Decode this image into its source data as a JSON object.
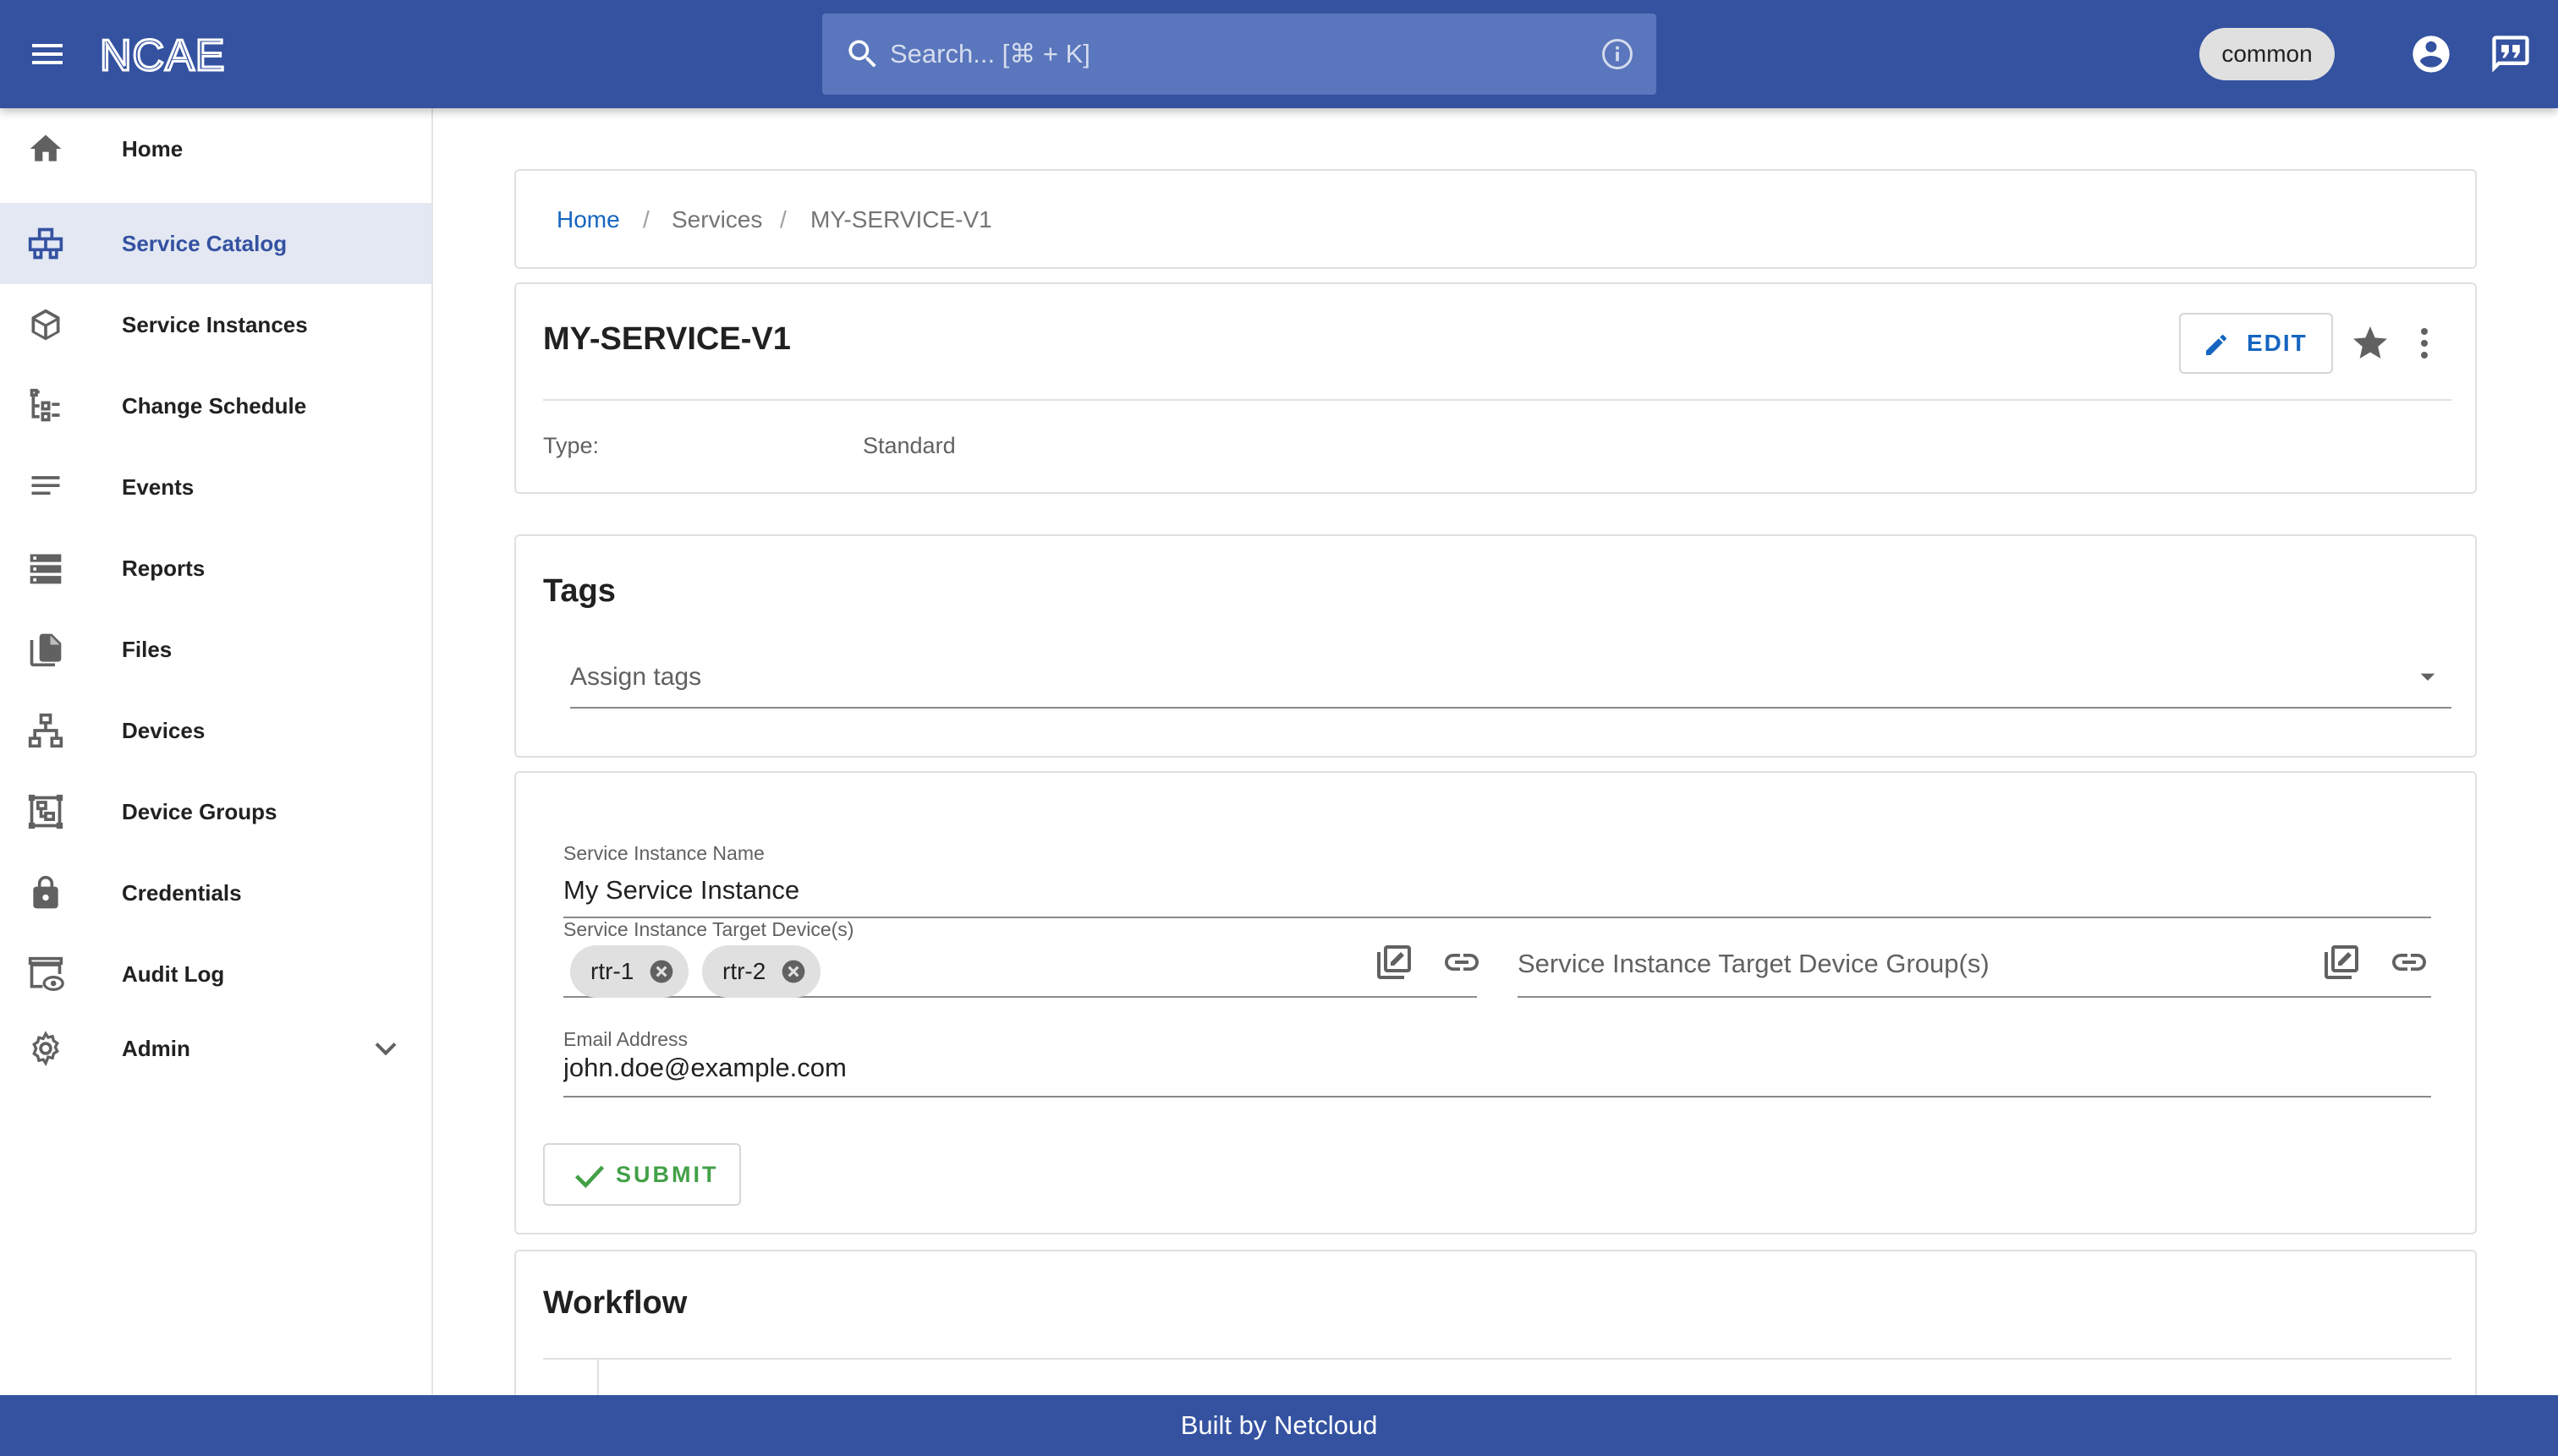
{
  "header": {
    "logo_text": "NCAE",
    "search_placeholder": "Search... [⌘ + K]",
    "user_chip": "common",
    "bar_color": "#3452a0"
  },
  "sidebar": {
    "items": [
      {
        "label": "Home",
        "icon": "home-icon"
      },
      {
        "label": "Service Catalog",
        "icon": "catalog-icon",
        "active": true
      },
      {
        "label": "Service Instances",
        "icon": "cube-icon"
      },
      {
        "label": "Change Schedule",
        "icon": "tree-list-icon"
      },
      {
        "label": "Events",
        "icon": "lines-icon"
      },
      {
        "label": "Reports",
        "icon": "storage-icon"
      },
      {
        "label": "Files",
        "icon": "files-icon"
      },
      {
        "label": "Devices",
        "icon": "network-icon"
      },
      {
        "label": "Device Groups",
        "icon": "device-groups-icon"
      },
      {
        "label": "Credentials",
        "icon": "lock-icon"
      },
      {
        "label": "Audit Log",
        "icon": "audit-icon"
      },
      {
        "label": "Admin",
        "icon": "gear-icon"
      }
    ]
  },
  "breadcrumb": {
    "home": "Home",
    "sep": "/",
    "services": "Services",
    "current": "MY-SERVICE-V1"
  },
  "service": {
    "title": "MY-SERVICE-V1",
    "edit_label": "EDIT",
    "type_label": "Type:",
    "type_value": "Standard"
  },
  "tags": {
    "title": "Tags",
    "placeholder": "Assign tags"
  },
  "form": {
    "name_label": "Service Instance Name",
    "name_value": "My Service Instance",
    "devices_label": "Service Instance Target Device(s)",
    "devices": [
      "rtr-1",
      "rtr-2"
    ],
    "groups_placeholder": "Service Instance Target Device Group(s)",
    "email_label": "Email Address",
    "email_value": "john.doe@example.com",
    "submit_label": "SUBMIT"
  },
  "workflow": {
    "title": "Workflow"
  },
  "footer": {
    "text": "Built by Netcloud"
  }
}
